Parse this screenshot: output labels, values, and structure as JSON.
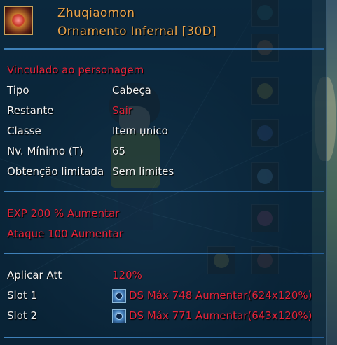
{
  "item": {
    "icon": "infernal-ornament-icon",
    "name": "Zhuqiaomon",
    "type_line": "Ornamento Infernal [30D]"
  },
  "binding": "Vinculado ao personagem",
  "properties": [
    {
      "label": "Tipo",
      "value": "Cabeça"
    },
    {
      "label": "Restante",
      "value": "Sair"
    },
    {
      "label": "Classe",
      "value": "Item џnico"
    },
    {
      "label": "Nv. Mínimo (T)",
      "value": "65"
    },
    {
      "label": "Obtenção limitada",
      "value": "Sem limites"
    }
  ],
  "bonuses": [
    "EXP 200 % Aumentar",
    "Ataque 100 Aumentar"
  ],
  "attributes": {
    "apply_label": "Aplicar Att",
    "apply_value": "120%",
    "slots": [
      {
        "label": "Slot 1",
        "icon": "ds-orb-icon",
        "value": "DS Máx 748 Aumentar(624x120%)"
      },
      {
        "label": "Slot 2",
        "icon": "ds-orb-icon",
        "value": "DS Máx 771 Aumentar(643x120%)"
      }
    ]
  },
  "colors": {
    "title": "#e8a24a",
    "highlight_red": "#e2243a",
    "text_white": "#f2f2f2",
    "separator": "#3f8cc8"
  }
}
